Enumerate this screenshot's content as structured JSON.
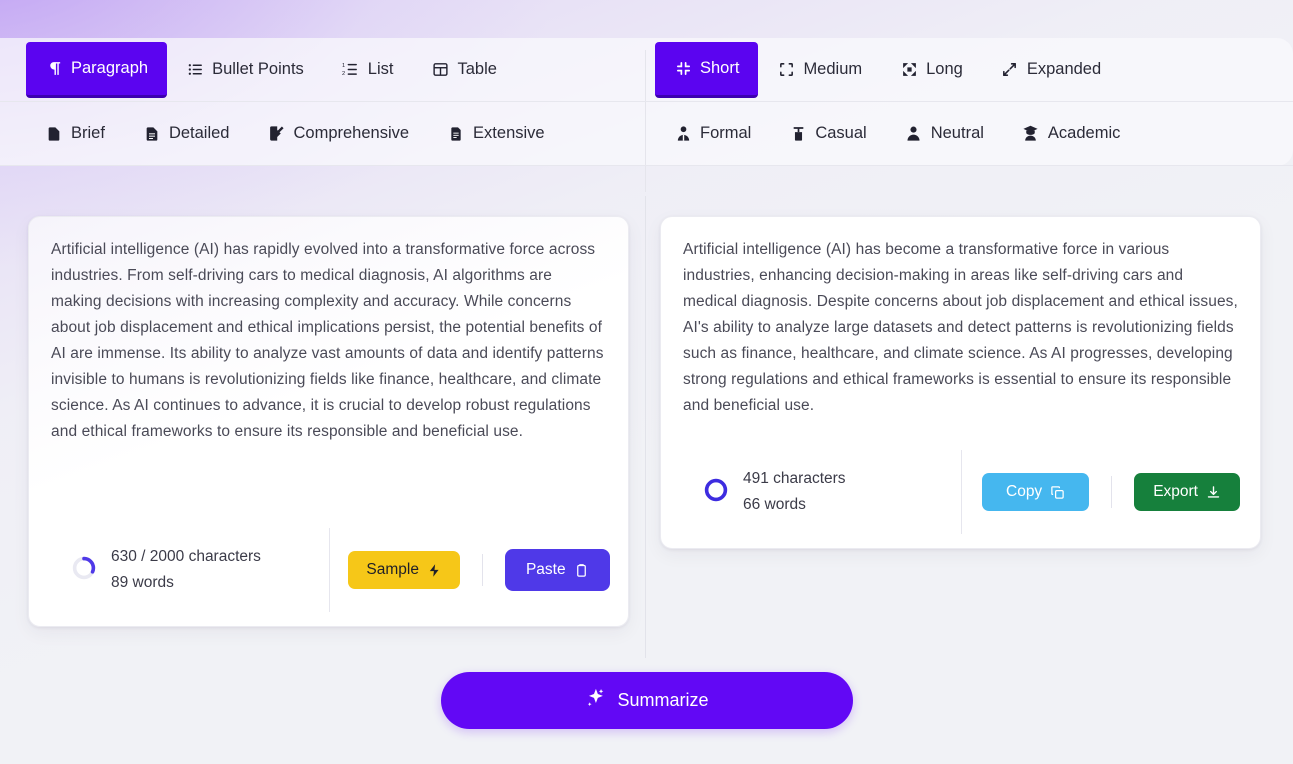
{
  "format_tabs": {
    "selected": "Paragraph",
    "items": [
      {
        "label": "Paragraph",
        "icon": "pilcrow-icon"
      },
      {
        "label": "Bullet Points",
        "icon": "bullet-list-icon"
      },
      {
        "label": "List",
        "icon": "numbered-list-icon"
      },
      {
        "label": "Table",
        "icon": "table-icon"
      }
    ]
  },
  "detail_tabs": {
    "selected": "",
    "items": [
      {
        "label": "Brief",
        "icon": "document-icon"
      },
      {
        "label": "Detailed",
        "icon": "document-lines-icon"
      },
      {
        "label": "Comprehensive",
        "icon": "document-edit-icon"
      },
      {
        "label": "Extensive",
        "icon": "document-stack-icon"
      }
    ]
  },
  "length_tabs": {
    "selected": "Short",
    "items": [
      {
        "label": "Short",
        "icon": "shrink-icon"
      },
      {
        "label": "Medium",
        "icon": "crop-frame-icon"
      },
      {
        "label": "Long",
        "icon": "expand-corners-icon"
      },
      {
        "label": "Expanded",
        "icon": "diagonal-arrows-icon"
      }
    ]
  },
  "tone_tabs": {
    "selected": "",
    "items": [
      {
        "label": "Formal",
        "icon": "person-tie-icon"
      },
      {
        "label": "Casual",
        "icon": "person-casual-icon"
      },
      {
        "label": "Neutral",
        "icon": "person-icon"
      },
      {
        "label": "Academic",
        "icon": "graduate-cap-person-icon"
      }
    ]
  },
  "input_panel": {
    "text": "Artificial intelligence (AI) has rapidly evolved into a transformative force across industries. From self-driving cars to medical diagnosis, AI algorithms are making decisions with increasing complexity and accuracy. While concerns about job displacement and ethical implications persist, the potential benefits of AI are immense. Its ability to analyze vast amounts of data and identify patterns invisible to humans is revolutionizing fields like finance, healthcare, and climate science. As AI continues to advance, it is crucial to develop robust regulations and ethical frameworks to ensure its responsible and beneficial use.",
    "char_count": "630 / 2000 characters",
    "word_count": "89 words",
    "progress_percent": 31.5,
    "progress_color": "#4f39e8",
    "sample_label": "Sample",
    "sample_icon": "lightning-bolt-icon",
    "paste_label": "Paste",
    "paste_icon": "clipboard-icon"
  },
  "output_panel": {
    "text": "Artificial intelligence (AI) has become a transformative force in various industries, enhancing decision-making in areas like self-driving cars and medical diagnosis. Despite concerns about job displacement and ethical issues, AI's ability to analyze large datasets and detect patterns is revolutionizing fields such as finance, healthcare, and climate science. As AI progresses, developing strong regulations and ethical frameworks is essential to ensure its responsible and beneficial use.",
    "char_count": "491 characters",
    "word_count": "66 words",
    "progress_percent": 100,
    "progress_color": "#3d2ce0",
    "copy_label": "Copy",
    "copy_icon": "copy-icon",
    "export_label": "Export",
    "export_icon": "download-icon"
  },
  "summarize": {
    "label": "Summarize",
    "icon": "sparkle-icon"
  },
  "colors": {
    "accent": "#5b04f0",
    "summarize": "#6208f5",
    "sample": "#f6c718",
    "paste": "#4f39e8",
    "copy": "#45b7ef",
    "export": "#16803c",
    "page_bg": "#f1f2f6"
  }
}
